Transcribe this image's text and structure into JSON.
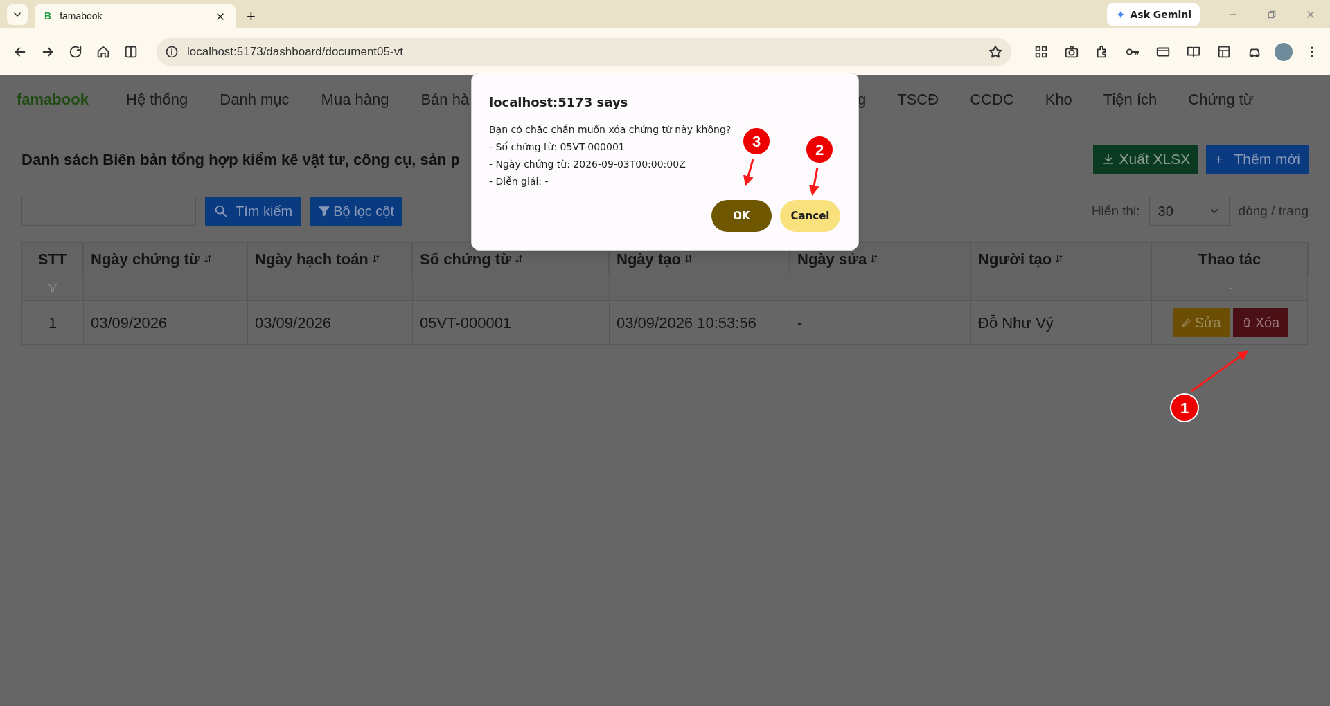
{
  "browser": {
    "tab_favicon": "B",
    "tab_title": "famabook",
    "new_tab": "+",
    "ask_button": "Ask Gemini",
    "url": "localhost:5173/dashboard/document05-vt"
  },
  "nav": {
    "logo": "famabook",
    "items_left": [
      "Hệ thống",
      "Danh mục",
      "Mua hàng",
      "Bán hà"
    ],
    "items_right": [
      "g",
      "TSCĐ",
      "CCDC",
      "Kho",
      "Tiện ích",
      "Chứng từ"
    ]
  },
  "page": {
    "title": "Danh sách Biên bản tổng hợp kiểm kê vật tư, công cụ, sản p",
    "search_button": "Tìm kiếm",
    "filter_button": "Bộ lọc cột",
    "export_button": "Xuất XLSX",
    "add_button": {
      "icon": "+",
      "label": "Thêm mới"
    },
    "page_size": {
      "label": "Hiển thị:",
      "value": "30",
      "suffix": "dòng / trang"
    }
  },
  "table": {
    "columns": [
      {
        "label": "STT",
        "sortable": false
      },
      {
        "label": "Ngày chứng từ",
        "sortable": true
      },
      {
        "label": "Ngày hạch toán",
        "sortable": true
      },
      {
        "label": "Số chứng từ",
        "sortable": true
      },
      {
        "label": "Ngày tạo",
        "sortable": true
      },
      {
        "label": "Ngày sửa",
        "sortable": true
      },
      {
        "label": "Người tạo",
        "sortable": true
      },
      {
        "label": "Thao tác",
        "sortable": false
      }
    ],
    "filter_actions": "-",
    "rows": [
      {
        "cells": [
          "1",
          "03/09/2026",
          "03/09/2026",
          "05VT-000001",
          "03/09/2026 10:53:56",
          "-",
          "Đỗ Như Vý"
        ],
        "actions": [
          {
            "kind": "edit",
            "label": "Sửa"
          },
          {
            "kind": "delete",
            "label": "Xóa"
          }
        ]
      }
    ]
  },
  "dialog": {
    "title": "localhost:5173 says",
    "lines": [
      "Bạn có chắc chắn muốn xóa chứng từ này không?",
      "- Số chứng từ: 05VT-000001",
      "- Ngày chứng từ: 2026-09-03T00:00:00Z",
      "- Diễn giải: -"
    ],
    "buttons": [
      {
        "kind": "primary",
        "label": "OK"
      },
      {
        "kind": "secondary",
        "label": "Cancel"
      }
    ]
  },
  "callouts": [
    {
      "label": "1"
    },
    {
      "label": "2"
    },
    {
      "label": "3"
    }
  ]
}
